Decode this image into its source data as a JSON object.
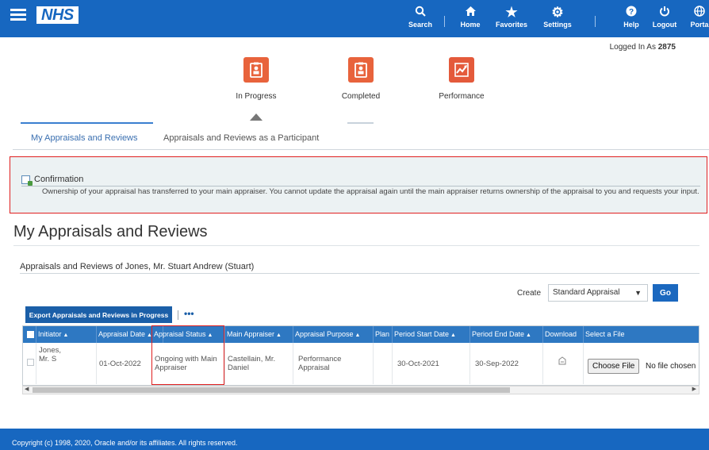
{
  "topbar": {
    "logo": "NHS",
    "items": [
      {
        "label": "Search",
        "icon": "search-icon"
      },
      {
        "label": "Home",
        "icon": "home-icon"
      },
      {
        "label": "Favorites",
        "icon": "star-icon"
      },
      {
        "label": "Settings",
        "icon": "gear-icon"
      },
      {
        "label": "Help",
        "icon": "help-icon"
      },
      {
        "label": "Logout",
        "icon": "power-icon"
      },
      {
        "label": "Porta",
        "icon": "globe-icon"
      }
    ]
  },
  "logged_in": {
    "prefix": "Logged In As",
    "user": "2875"
  },
  "train": {
    "steps": [
      {
        "label": "In Progress",
        "icon": "appraisal-icon"
      },
      {
        "label": "Completed",
        "icon": "appraisal-icon"
      },
      {
        "label": "Performance",
        "icon": "chart-icon"
      }
    ]
  },
  "tabs": [
    {
      "label": "My Appraisals and Reviews",
      "active": true
    },
    {
      "label": "Appraisals and Reviews as a Participant",
      "active": false
    }
  ],
  "confirmation": {
    "title": "Confirmation",
    "message": "Ownership of your appraisal has transferred to your main appraiser. You cannot update the appraisal again until the main appraiser returns ownership of the appraisal to you and requests your input."
  },
  "page_title": "My Appraisals and Reviews",
  "section_header": "Appraisals and Reviews of Jones, Mr. Stuart Andrew (Stuart)",
  "create": {
    "label": "Create",
    "selected": "Standard Appraisal",
    "go_label": "Go"
  },
  "toolbar": {
    "export_label": "Export Appraisals and Reviews in Progress",
    "more_label": "•••"
  },
  "table": {
    "columns": [
      "Initiator",
      "Appraisal Date",
      "Appraisal Status",
      "Main Appraiser",
      "Appraisal Purpose",
      "Plan",
      "Period Start Date",
      "Period End Date",
      "Download",
      "Select a File"
    ],
    "row": {
      "initiator": "Jones, Mr. S",
      "appraisal_date": "01-Oct-2022",
      "appraisal_status": "Ongoing with Main Appraiser",
      "main_appraiser": "Castellain, Mr. Daniel",
      "appraisal_purpose": "Performance Appraisal",
      "plan": "",
      "period_start": "30-Oct-2021",
      "period_end": "30-Sep-2022",
      "choose_file_label": "Choose File",
      "no_file_label": "No file chosen"
    }
  },
  "footer": {
    "copyright": "Copyright (c) 1998, 2020, Oracle and/or its affiliates. All rights reserved."
  },
  "colors": {
    "brand": "#1767c0",
    "header": "#2e78c2",
    "highlight": "#e02020",
    "train": "#e8633c"
  }
}
